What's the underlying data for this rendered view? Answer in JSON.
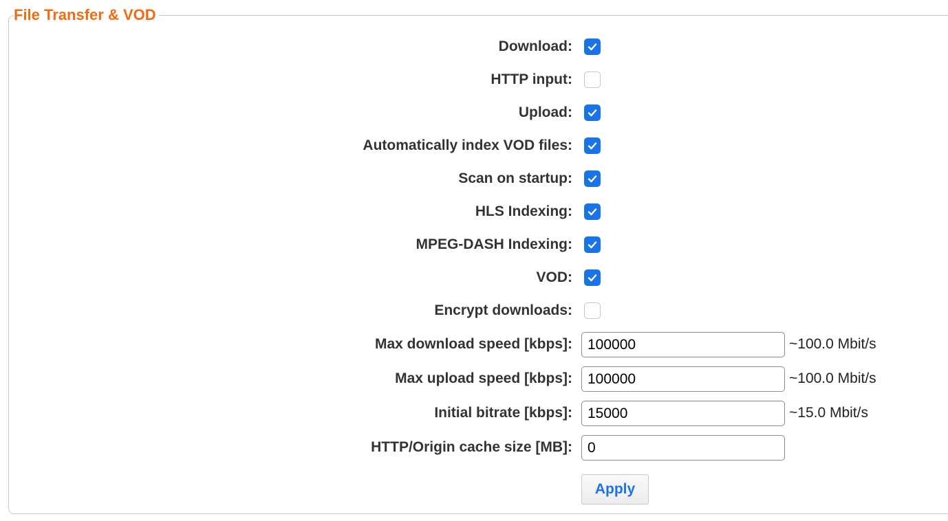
{
  "section": {
    "title": "File Transfer & VOD"
  },
  "checkboxes": [
    {
      "label": "Download:",
      "checked": true
    },
    {
      "label": "HTTP input:",
      "checked": false
    },
    {
      "label": "Upload:",
      "checked": true
    },
    {
      "label": "Automatically index VOD files:",
      "checked": true
    },
    {
      "label": "Scan on startup:",
      "checked": true
    },
    {
      "label": "HLS Indexing:",
      "checked": true
    },
    {
      "label": "MPEG-DASH Indexing:",
      "checked": true
    },
    {
      "label": "VOD:",
      "checked": true
    },
    {
      "label": "Encrypt downloads:",
      "checked": false
    }
  ],
  "fields": [
    {
      "label": "Max download speed [kbps]:",
      "value": "100000",
      "hint": "~100.0 Mbit/s"
    },
    {
      "label": "Max upload speed [kbps]:",
      "value": "100000",
      "hint": "~100.0 Mbit/s"
    },
    {
      "label": "Initial bitrate [kbps]:",
      "value": "15000",
      "hint": "~15.0 Mbit/s"
    },
    {
      "label": "HTTP/Origin cache size [MB]:",
      "value": "0",
      "hint": ""
    }
  ],
  "apply_label": "Apply",
  "colors": {
    "accent": "#1a73e8",
    "title": "#f26b0f"
  }
}
